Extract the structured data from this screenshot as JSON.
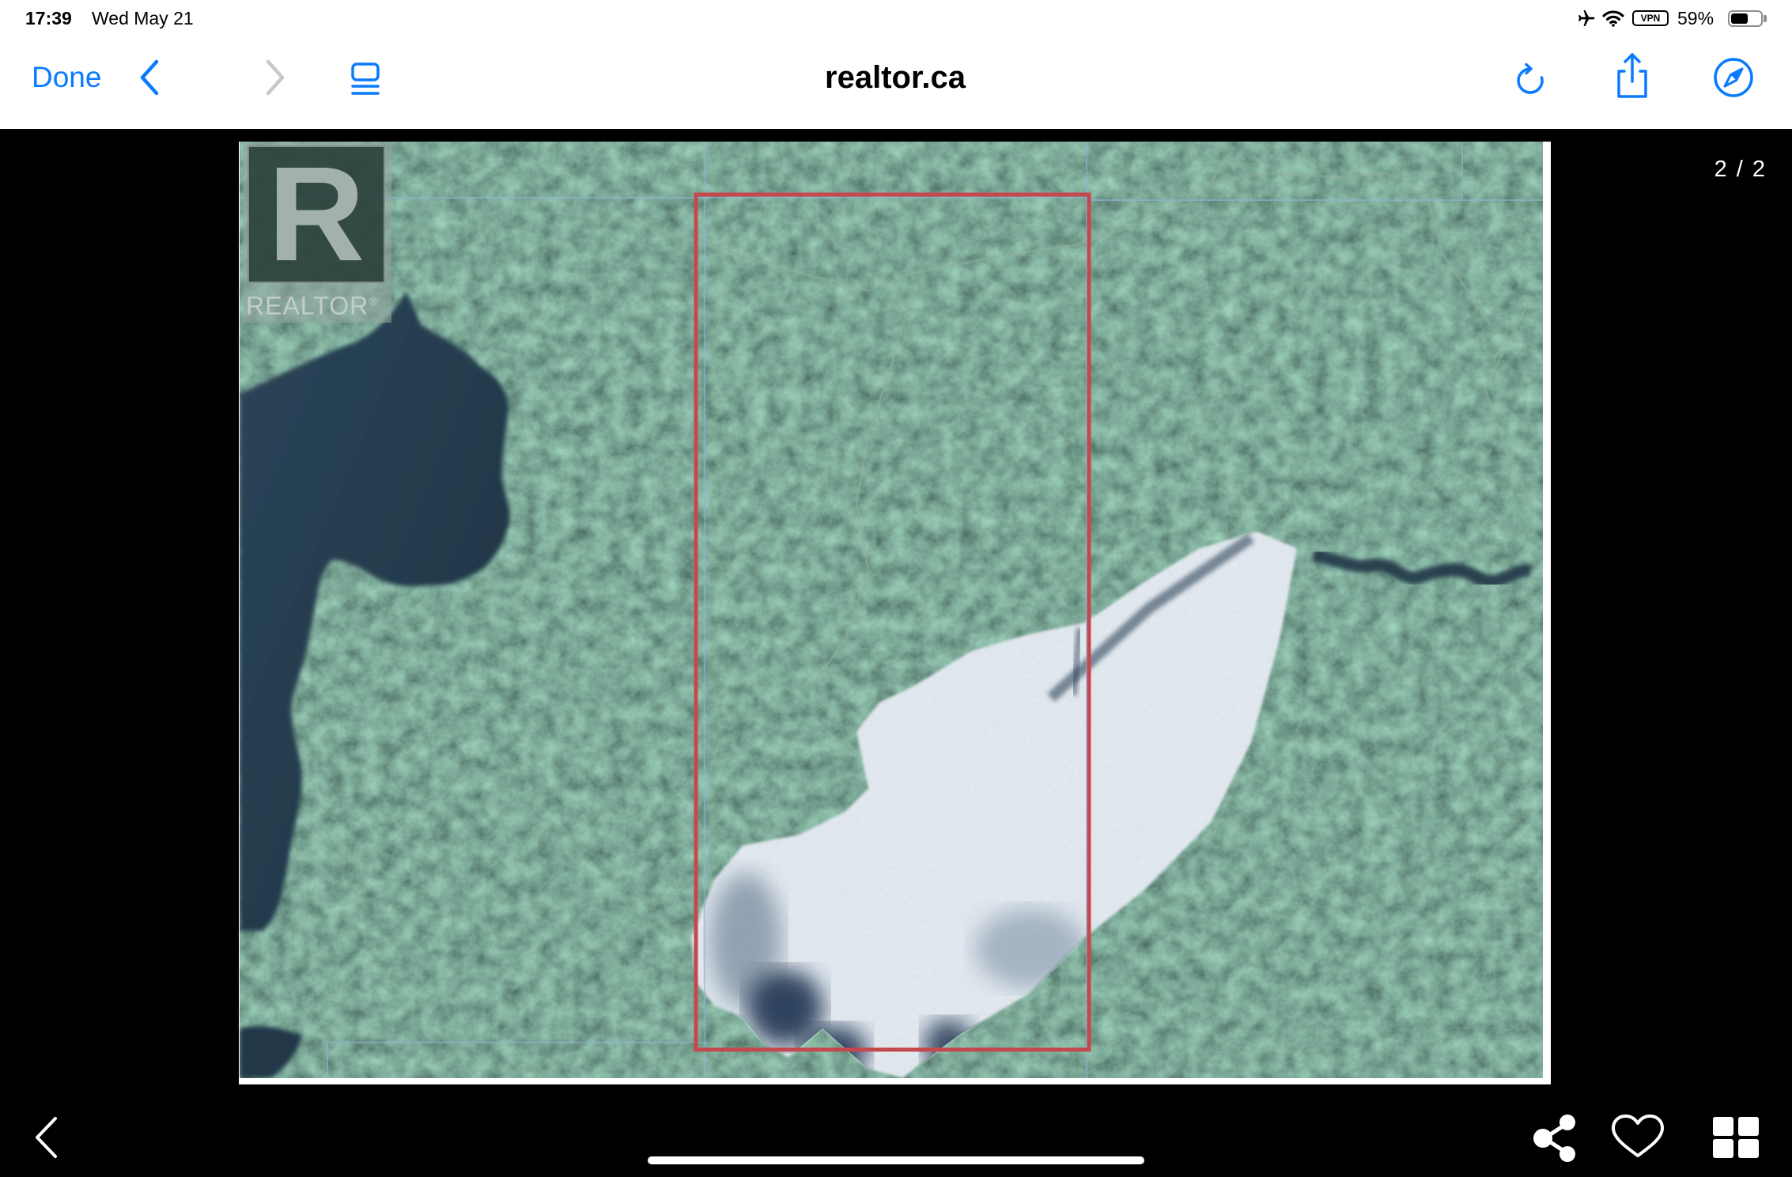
{
  "status_bar": {
    "time": "17:39",
    "date": "Wed May 21",
    "vpn_label": "VPN",
    "battery_text": "59%",
    "battery_level": 0.59
  },
  "nav_bar": {
    "done_label": "Done",
    "address": "realtor.ca"
  },
  "viewer": {
    "counter": "2 / 2"
  },
  "photo": {
    "logo_mark": "R",
    "logo_text": "REALTOR",
    "logo_reg": "®"
  },
  "icons": {
    "status_bar": [
      "airplane-icon",
      "wifi-icon",
      "vpn-badge",
      "battery-icon"
    ],
    "nav_bar": [
      "chevron-left-icon",
      "chevron-right-icon",
      "tabs-icon",
      "reload-icon",
      "share-icon",
      "compass-icon"
    ],
    "bottom_bar": [
      "chevron-left-icon",
      "share-network-icon",
      "heart-icon",
      "grid-icon"
    ]
  },
  "colors": {
    "accent": "#0a7aff",
    "disabled": "#c7c7cc",
    "chrome_background": "#ffffff",
    "viewer_background": "#000000",
    "parcel_outline": "#c4484d"
  }
}
